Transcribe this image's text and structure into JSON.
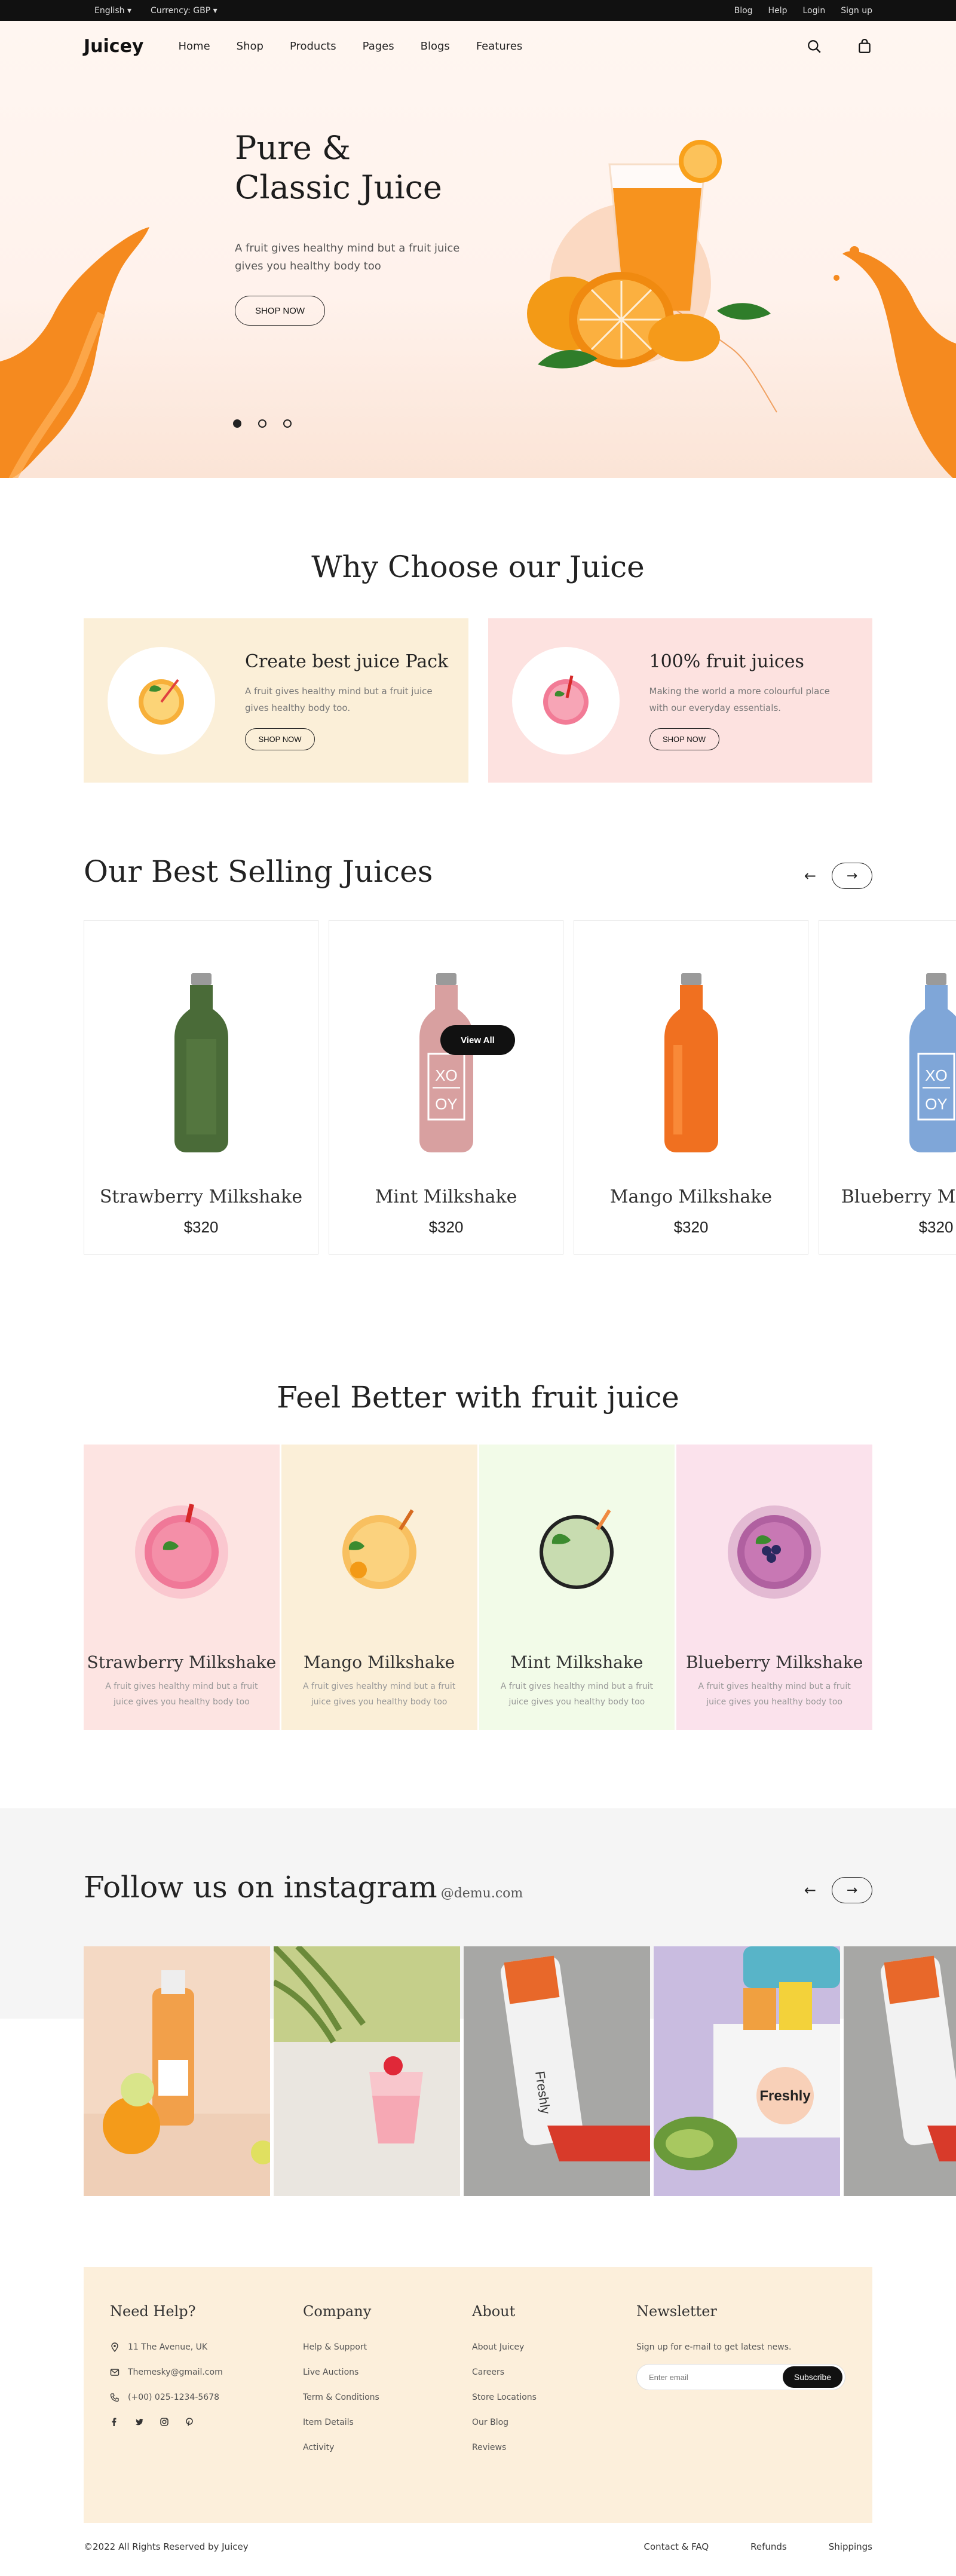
{
  "topbar": {
    "language": "English",
    "currency": "Currency: GBP",
    "links": [
      "Blog",
      "Help",
      "Login",
      "Sign up"
    ]
  },
  "header": {
    "logo": "Juicey",
    "menu": [
      "Home",
      "Shop",
      "Products",
      "Pages",
      "Blogs",
      "Features"
    ],
    "icons": [
      "search-icon",
      "bag-icon"
    ]
  },
  "hero": {
    "title_line1": "Pure &",
    "title_line2": "Classic Juice",
    "subtitle": "A fruit gives healthy mind but a fruit juice gives you healthy body too",
    "button": "SHOP NOW",
    "slides": 3,
    "active_slide": 1
  },
  "why": {
    "title": "Why Choose our Juice",
    "cards": [
      {
        "title": "Create best juice Pack",
        "text": "A fruit gives healthy mind but a fruit juice gives healthy body too.",
        "button": "SHOP NOW",
        "bg": "#fbefd8"
      },
      {
        "title": "100% fruit juices",
        "text": "Making the world a more colourful place with our everyday essentials.",
        "button": "SHOP NOW",
        "bg": "#fde2e0"
      }
    ]
  },
  "best": {
    "title": "Our Best Selling Juices",
    "products": [
      {
        "name": "Strawberry Milkshake",
        "price": "$320",
        "color": "#4a6b38"
      },
      {
        "name": "Mint Milkshake",
        "price": "$320",
        "color": "#d8a0a0"
      },
      {
        "name": "Mango Milkshake",
        "price": "$320",
        "color": "#f07020"
      },
      {
        "name": "Blueberry Milkshake",
        "price": "$320",
        "color": "#7fa6d8"
      }
    ],
    "view_all": "View All"
  },
  "feel": {
    "title": "Feel Better with fruit juice",
    "cards": [
      {
        "name": "Strawberry Milkshake",
        "text": "A fruit gives healthy mind but a fruit juice gives you healthy body too",
        "bg": "#fde4e2",
        "juice": "#f07898"
      },
      {
        "name": "Mango Milkshake",
        "text": "A fruit gives healthy mind but a fruit juice gives you healthy body too",
        "bg": "#fbefd8",
        "juice": "#f8c060"
      },
      {
        "name": "Mint Milkshake",
        "text": "A fruit gives healthy mind but a fruit juice gives you healthy body too",
        "bg": "#f2fbe8",
        "juice": "#c8dcb0"
      },
      {
        "name": "Blueberry Milkshake",
        "text": "A fruit gives healthy mind but a fruit juice gives you healthy body too",
        "bg": "#fbe2ec",
        "juice": "#b060a0"
      }
    ]
  },
  "instagram": {
    "title": "Follow us on instagram",
    "handle": "@demu.com",
    "brand_label": "Freshly"
  },
  "footer": {
    "help": {
      "title": "Need Help?",
      "address": "11 The Avenue, UK",
      "email": "Themesky@gmail.com",
      "phone": "(+00) 025-1234-5678"
    },
    "company": {
      "title": "Company",
      "links": [
        "Help & Support",
        "Live Auctions",
        "Term & Conditions",
        "Item Details",
        "Activity"
      ]
    },
    "about": {
      "title": "About",
      "links": [
        "About Juicey",
        "Careers",
        "Store Locations",
        "Our Blog",
        "Reviews"
      ]
    },
    "newsletter": {
      "title": "Newsletter",
      "text": "Sign up for e-mail to get latest news.",
      "placeholder": "Enter email",
      "button": "Subscribe"
    },
    "social": [
      "facebook-icon",
      "twitter-icon",
      "instagram-icon",
      "pinterest-icon"
    ],
    "copyright": "©2022 All Rights Reserved by Juicey",
    "links": [
      "Contact & FAQ",
      "Refunds",
      "Shippings"
    ]
  }
}
